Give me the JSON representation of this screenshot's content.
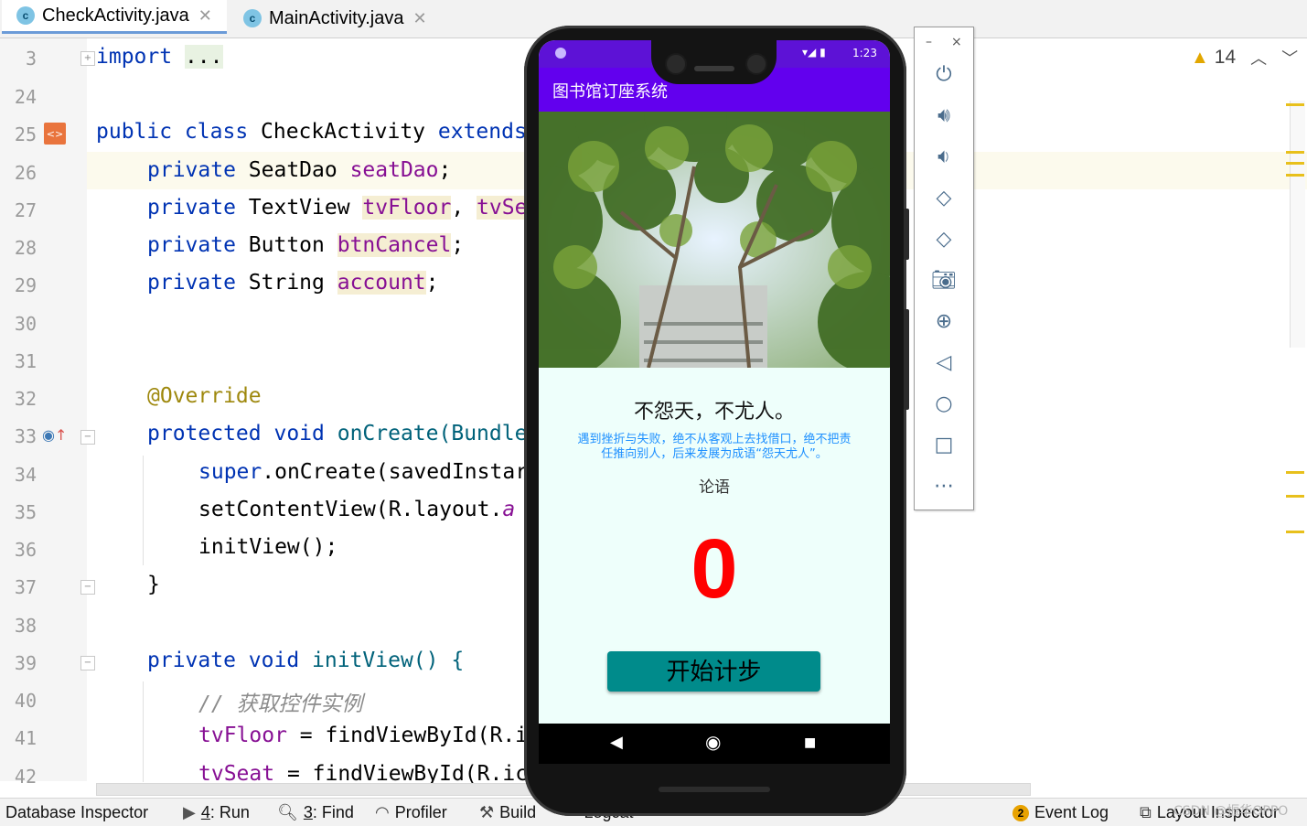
{
  "tabs": [
    {
      "label": "CheckActivity.java",
      "icon": "c",
      "active": true
    },
    {
      "label": "MainActivity.java",
      "icon": "c",
      "active": false
    }
  ],
  "line_numbers": [
    "3",
    "24",
    "25",
    "26",
    "27",
    "28",
    "29",
    "30",
    "31",
    "32",
    "33",
    "34",
    "35",
    "36",
    "37",
    "38",
    "39",
    "40",
    "41",
    "42"
  ],
  "code": {
    "l3_import": "import",
    "l3_folded": "...",
    "l25_a": "public class ",
    "l25_b": "CheckActivity ",
    "l25_c": "extends",
    "l26_a": "private ",
    "l26_b": "SeatDao ",
    "l26_c": "seatDao",
    "l26_d": ";",
    "l27_a": "private ",
    "l27_b": "TextView ",
    "l27_c": "tvFloor",
    "l27_d": ", ",
    "l27_e": "tvSe",
    "l28_a": "private ",
    "l28_b": "Button ",
    "l28_c": "btnCancel",
    "l28_d": ";",
    "l29_a": "private ",
    "l29_b": "String ",
    "l29_c": "account",
    "l29_d": ";",
    "l32": "@Override",
    "l33_a": "protected void ",
    "l33_b": "onCreate(Bundle",
    "l34_a": "super",
    "l34_b": ".onCreate(savedInstar",
    "l35_a": "setContentView(R.layout.",
    "l35_b": "a",
    "l36": "initView();",
    "l37": "}",
    "l39_a": "private void ",
    "l39_b": "initView() {",
    "l40": "// 获取控件实例",
    "l41_a": "tvFloor",
    "l41_b": " = findViewById(R.i",
    "l42_a": "tvSeat",
    "l42_b": " = findViewById(R.ic"
  },
  "warnings": {
    "count": "14",
    "icon": "warning-triangle-icon"
  },
  "emulator_panel": {
    "minimize": "–",
    "close": "×",
    "buttons": [
      "power-icon",
      "volume-up-icon",
      "volume-down-icon",
      "rotate-left-icon",
      "rotate-right-icon",
      "camera-icon",
      "zoom-icon",
      "back-icon",
      "home-icon",
      "overview-icon",
      "more-icon"
    ]
  },
  "phone": {
    "status_time": "1:23",
    "app_title": "图书馆订座系统",
    "quote_main": "不怨天，不尤人。",
    "quote_explain_1": "遇到挫折与失败，绝不从客观上去找借口，绝不把责",
    "quote_explain_2": "任推向别人，后来发展为成语“怨天尤人”。",
    "quote_source": "论语",
    "step_count": "0",
    "start_button": "开始计步",
    "colors": {
      "appbar": "#6200ee",
      "statusbar": "#5d12d6",
      "count": "#ff0000",
      "button": "#008b8b",
      "explain": "#1e90ff"
    }
  },
  "bottom_bar": {
    "database_inspector": "Database Inspector",
    "run_num": "4",
    "run": ": Run",
    "find_num": "3",
    "find": ": Find",
    "profiler": "Profiler",
    "build": "Build",
    "logcat": "Logcat",
    "event_log_badge": "2",
    "event_log": "Event Log",
    "layout_inspector": "Layout Inspector"
  },
  "watermark": "CSDN @振华OPPO"
}
